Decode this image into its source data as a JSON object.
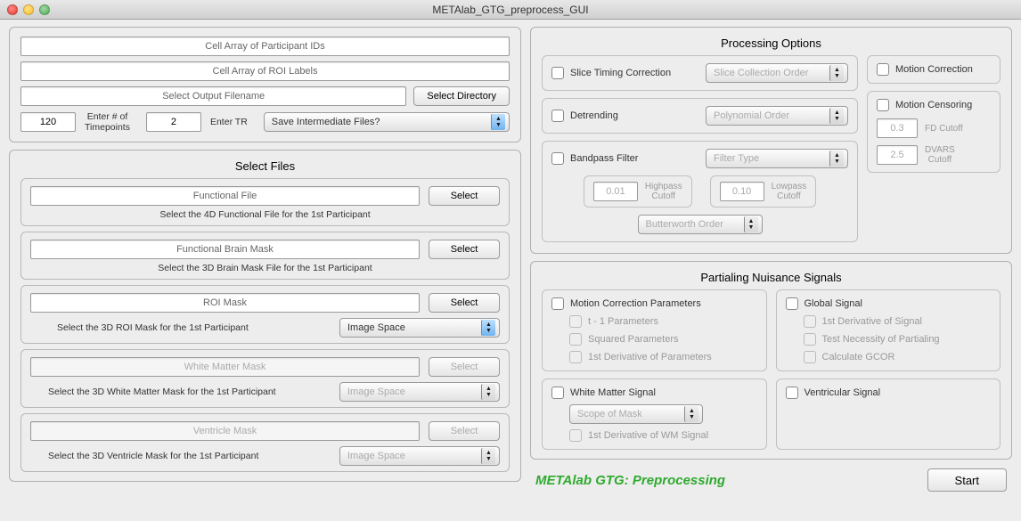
{
  "window": {
    "title": "METAlab_GTG_preprocess_GUI"
  },
  "top": {
    "participant_ids": "Cell Array of Participant IDs",
    "roi_labels": "Cell Array of ROI Labels",
    "output_filename": "Select Output Filename",
    "select_directory_btn": "Select Directory",
    "timepoints_value": "120",
    "timepoints_label": "Enter # of\nTimepoints",
    "tr_value": "2",
    "tr_label": "Enter TR",
    "save_intermediate": "Save Intermediate Files?"
  },
  "select_files": {
    "title": "Select Files",
    "select_btn": "Select",
    "functional": {
      "field": "Functional File",
      "help": "Select the 4D Functional File for the 1st Participant"
    },
    "brainmask": {
      "field": "Functional Brain Mask",
      "help": "Select the 3D Brain Mask File for the 1st Participant"
    },
    "roimask": {
      "field": "ROI Mask",
      "help": "Select the 3D ROI Mask for the 1st Participant",
      "image_space": "Image Space"
    },
    "wm": {
      "field": "White Matter Mask",
      "help": "Select the 3D White Matter Mask for the 1st Participant",
      "image_space": "Image Space"
    },
    "ventricle": {
      "field": "Ventricle Mask",
      "help": "Select the 3D Ventricle Mask for the 1st Participant",
      "image_space": "Image Space"
    }
  },
  "processing": {
    "title": "Processing Options",
    "slice_timing": {
      "label": "Slice Timing Correction",
      "select": "Slice Collection Order"
    },
    "detrending": {
      "label": "Detrending",
      "select": "Polynomial Order"
    },
    "bandpass": {
      "label": "Bandpass Filter",
      "filter_type": "Filter Type",
      "highpass_value": "0.01",
      "highpass_label": "Highpass\nCutoff",
      "lowpass_value": "0.10",
      "lowpass_label": "Lowpass\nCutoff",
      "butterworth": "Butterworth Order"
    },
    "motion_correction": "Motion Correction",
    "motion_censoring": {
      "label": "Motion Censoring",
      "fd_value": "0.3",
      "fd_label": "FD Cutoff",
      "dvars_value": "2.5",
      "dvars_label": "DVARS\nCutoff"
    }
  },
  "nuisance": {
    "title": "Partialing Nuisance Signals",
    "motion_params": {
      "label": "Motion Correction Parameters",
      "t1": "t - 1 Parameters",
      "squared": "Squared Parameters",
      "deriv": "1st Derivative of Parameters"
    },
    "global": {
      "label": "Global Signal",
      "deriv": "1st Derivative of Signal",
      "test": "Test Necessity of Partialing",
      "gcor": "Calculate GCOR"
    },
    "wm": {
      "label": "White Matter Signal",
      "scope": "Scope of Mask",
      "deriv": "1st Derivative of WM Signal"
    },
    "ventricular": {
      "label": "Ventricular Signal"
    }
  },
  "footer": {
    "brand": "METAlab GTG: Preprocessing",
    "start_btn": "Start"
  }
}
